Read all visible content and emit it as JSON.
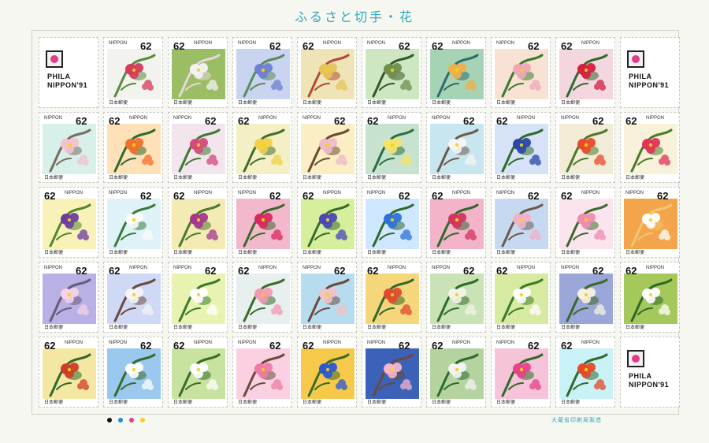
{
  "sheet": {
    "title": "ふるさと切手・花",
    "printer_mark": "大蔵省印刷局製造",
    "logo_lines": [
      "PHILA",
      "NIPPON'91"
    ],
    "color_dots": [
      "#111111",
      "#1f8ed6",
      "#e23b8a",
      "#f2d21b"
    ]
  },
  "stamp_defaults": {
    "face_value": "62",
    "country_en": "NIPPON",
    "country_jp": "日本郵便"
  },
  "rows": [
    [
      {
        "kind": "logo"
      },
      {
        "kind": "stamp",
        "palette": [
          "#d53b5a",
          "#f2f2ee",
          "#5a8a3a"
        ]
      },
      {
        "kind": "stamp",
        "palette": [
          "#f3f3f3",
          "#9bbd63",
          "#e6d7dc"
        ]
      },
      {
        "kind": "stamp",
        "palette": [
          "#6f7fd0",
          "#c9d4f0",
          "#5a8a5a"
        ]
      },
      {
        "kind": "stamp",
        "palette": [
          "#e6c45a",
          "#efe4b8",
          "#b24a2e"
        ]
      },
      {
        "kind": "stamp",
        "palette": [
          "#6f8f4c",
          "#cfe6c3",
          "#2f5a2a"
        ]
      },
      {
        "kind": "stamp",
        "palette": [
          "#f0b04a",
          "#a7d3b5",
          "#2e6c6a"
        ]
      },
      {
        "kind": "stamp",
        "palette": [
          "#f1a6b8",
          "#f8e2d3",
          "#3a7a2e"
        ]
      },
      {
        "kind": "stamp",
        "palette": [
          "#d41f3e",
          "#f3d6de",
          "#2f6a2a"
        ]
      },
      {
        "kind": "logo"
      }
    ],
    [
      {
        "kind": "stamp",
        "palette": [
          "#f3c1cf",
          "#d8f0ea",
          "#7b6b5d"
        ]
      },
      {
        "kind": "stamp",
        "palette": [
          "#f26f2b",
          "#ffe1b7",
          "#2d6a2c"
        ]
      },
      {
        "kind": "stamp",
        "palette": [
          "#d44a7a",
          "#f3e5ee",
          "#3b7a2f"
        ]
      },
      {
        "kind": "stamp",
        "palette": [
          "#f0d248",
          "#f5efc6",
          "#3f6f2b"
        ]
      },
      {
        "kind": "stamp",
        "palette": [
          "#f0b9c8",
          "#fbeec5",
          "#6a4a2e"
        ]
      },
      {
        "kind": "stamp",
        "palette": [
          "#f5e46a",
          "#c7e3d0",
          "#2b6f3d"
        ]
      },
      {
        "kind": "stamp",
        "palette": [
          "#f5f5f5",
          "#c7e6ef",
          "#6f5a4a"
        ]
      },
      {
        "kind": "stamp",
        "palette": [
          "#2a47a8",
          "#d5e2f7",
          "#2f6a2a"
        ]
      },
      {
        "kind": "stamp",
        "palette": [
          "#e84a2c",
          "#f2ecd6",
          "#4b7a2c"
        ]
      },
      {
        "kind": "stamp",
        "palette": [
          "#e0335a",
          "#f7f2d9",
          "#4a7a2a"
        ]
      }
    ],
    [
      {
        "kind": "stamp",
        "palette": [
          "#6b3ca1",
          "#f8f1b8",
          "#4d8a2f"
        ]
      },
      {
        "kind": "stamp",
        "palette": [
          "#fafafa",
          "#dff2f7",
          "#3c7a3a"
        ]
      },
      {
        "kind": "stamp",
        "palette": [
          "#a5378f",
          "#f3ebb3",
          "#4a7a2c"
        ]
      },
      {
        "kind": "stamp",
        "palette": [
          "#d8295c",
          "#f2b8cc",
          "#3a6a2a"
        ]
      },
      {
        "kind": "stamp",
        "palette": [
          "#4a47b8",
          "#d6ef9c",
          "#3b6a2a"
        ]
      },
      {
        "kind": "stamp",
        "palette": [
          "#2c72d8",
          "#cfe8ff",
          "#2f6a2a"
        ]
      },
      {
        "kind": "stamp",
        "palette": [
          "#d3335f",
          "#f3b3c8",
          "#2c6a2a"
        ]
      },
      {
        "kind": "stamp",
        "palette": [
          "#f1b2c9",
          "#c7d9f0",
          "#6a5a4a"
        ]
      },
      {
        "kind": "stamp",
        "palette": [
          "#f28bb2",
          "#fbe4ee",
          "#3a6a2a"
        ]
      },
      {
        "kind": "stamp",
        "palette": [
          "#ffffff",
          "#f4a54b",
          "#f0c678"
        ]
      }
    ],
    [
      {
        "kind": "stamp",
        "palette": [
          "#f3d3e6",
          "#b9b0e6",
          "#6a5a7a"
        ]
      },
      {
        "kind": "stamp",
        "palette": [
          "#f4f4f4",
          "#cfd9f5",
          "#6b4a3c"
        ]
      },
      {
        "kind": "stamp",
        "palette": [
          "#ffffff",
          "#e9f3b1",
          "#3c7a2c"
        ]
      },
      {
        "kind": "stamp",
        "palette": [
          "#f39ab2",
          "#e7f0ee",
          "#3c6a2c"
        ]
      },
      {
        "kind": "stamp",
        "palette": [
          "#f1c2c6",
          "#b8dcef",
          "#6b4a3c"
        ]
      },
      {
        "kind": "stamp",
        "palette": [
          "#e04a2e",
          "#f6d67a",
          "#2f6a2c"
        ]
      },
      {
        "kind": "stamp",
        "palette": [
          "#f4f2e7",
          "#c9e3b7",
          "#2e6a2a"
        ]
      },
      {
        "kind": "stamp",
        "palette": [
          "#ffffff",
          "#d7eaa1",
          "#3c7a2c"
        ]
      },
      {
        "kind": "stamp",
        "palette": [
          "#f8f1df",
          "#9aa7d8",
          "#3a6a2a"
        ]
      },
      {
        "kind": "stamp",
        "palette": [
          "#ffffff",
          "#a4c85a",
          "#2f6a2a"
        ]
      }
    ],
    [
      {
        "kind": "stamp",
        "palette": [
          "#cf3b2a",
          "#f4e7a3",
          "#2f6a2a"
        ]
      },
      {
        "kind": "stamp",
        "palette": [
          "#ffffff",
          "#9bc8ef",
          "#3a6a2a"
        ]
      },
      {
        "kind": "stamp",
        "palette": [
          "#ffffff",
          "#c8e39f",
          "#3a6a2a"
        ]
      },
      {
        "kind": "stamp",
        "palette": [
          "#f07aa6",
          "#fbd0e3",
          "#6a4a3c"
        ]
      },
      {
        "kind": "stamp",
        "palette": [
          "#2b57d6",
          "#f6c94b",
          "#3a6a2a"
        ]
      },
      {
        "kind": "stamp",
        "palette": [
          "#f6b5c8",
          "#3b61b8",
          "#6a4a3c"
        ]
      },
      {
        "kind": "stamp",
        "palette": [
          "#f4f4f4",
          "#b5d3a1",
          "#2f6a2a"
        ]
      },
      {
        "kind": "stamp",
        "palette": [
          "#e9418a",
          "#f6c4d8",
          "#2f6a2a"
        ]
      },
      {
        "kind": "stamp",
        "palette": [
          "#e24a2a",
          "#c9f1f6",
          "#2f6a2a"
        ]
      },
      {
        "kind": "logo"
      }
    ]
  ]
}
